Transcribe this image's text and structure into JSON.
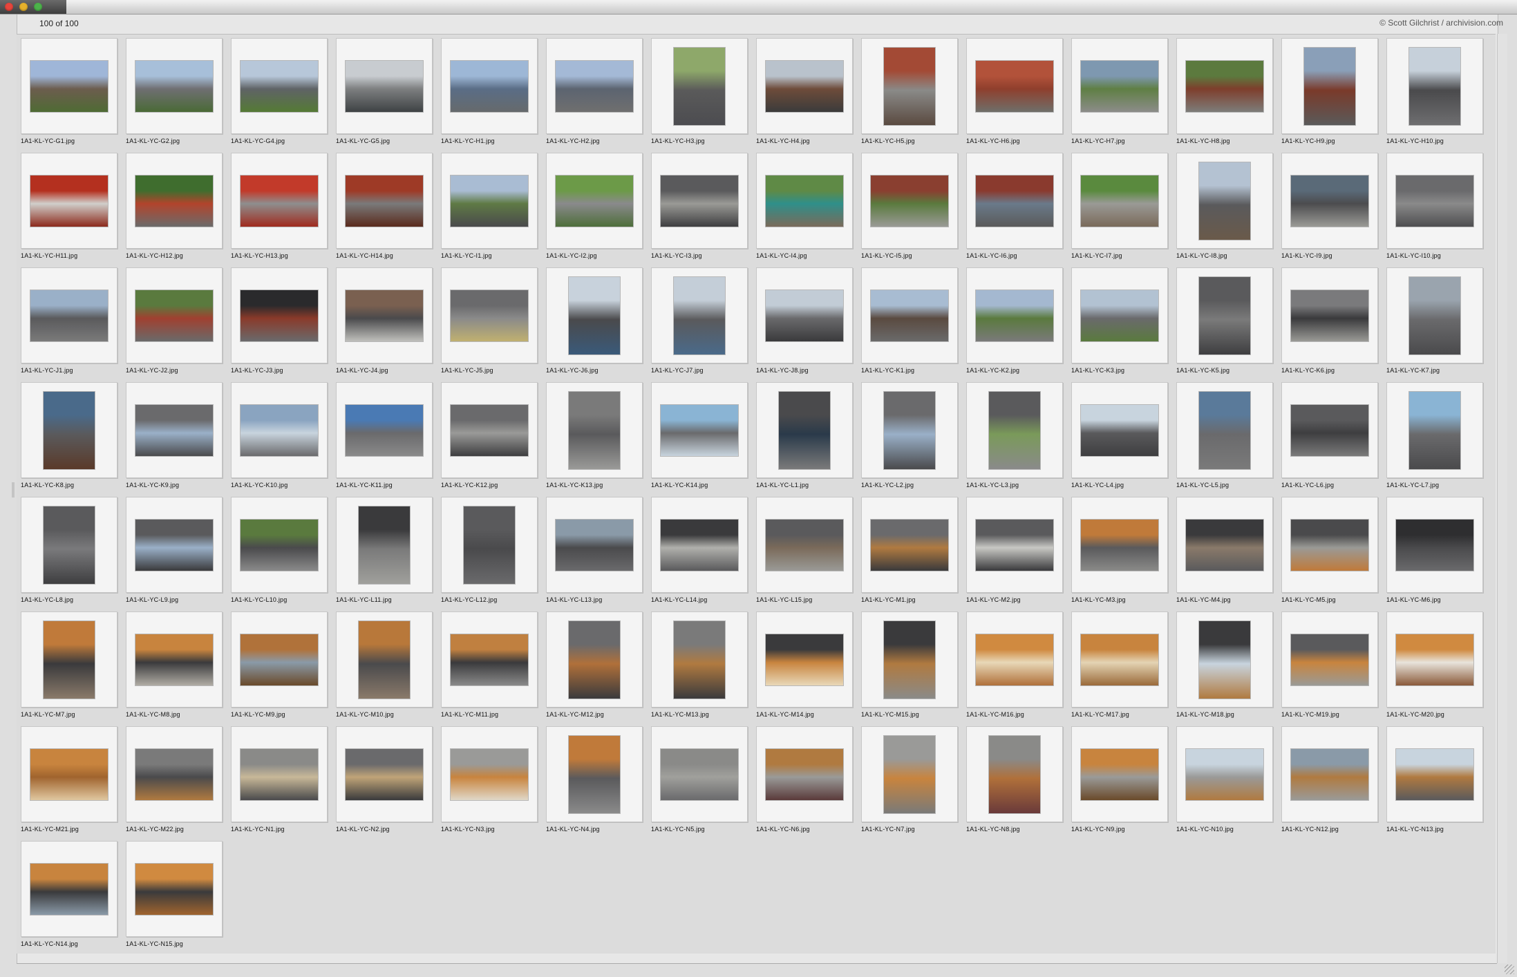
{
  "window": {
    "count_text": "100 of 100",
    "credit_text": "© Scott Gilchrist / archivision.com"
  },
  "thumbnails": [
    {
      "name": "1A1-KL-YC-G1.jpg",
      "orientation": "land",
      "colors": [
        "#9fb6d8",
        "#6c5d4e",
        "#4f6b34"
      ]
    },
    {
      "name": "1A1-KL-YC-G2.jpg",
      "orientation": "land",
      "colors": [
        "#a7bfd9",
        "#6f6f72",
        "#4a6a36"
      ]
    },
    {
      "name": "1A1-KL-YC-G4.jpg",
      "orientation": "land",
      "colors": [
        "#b7c7d9",
        "#5f6366",
        "#557a35"
      ]
    },
    {
      "name": "1A1-KL-YC-G5.jpg",
      "orientation": "land",
      "colors": [
        "#c8ccd0",
        "#7d7f80",
        "#3e4244"
      ]
    },
    {
      "name": "1A1-KL-YC-H1.jpg",
      "orientation": "land",
      "colors": [
        "#9db7d6",
        "#5a6d86",
        "#666a6c"
      ]
    },
    {
      "name": "1A1-KL-YC-H2.jpg",
      "orientation": "land",
      "colors": [
        "#a4b9d6",
        "#5c6470",
        "#6f6f6f"
      ]
    },
    {
      "name": "1A1-KL-YC-H3.jpg",
      "orientation": "port",
      "colors": [
        "#8ea86a",
        "#5a5a5a",
        "#4c4c50"
      ]
    },
    {
      "name": "1A1-KL-YC-H4.jpg",
      "orientation": "land",
      "colors": [
        "#b9c2cc",
        "#6e4c3a",
        "#3b3b3b"
      ]
    },
    {
      "name": "1A1-KL-YC-H5.jpg",
      "orientation": "port",
      "colors": [
        "#a34a35",
        "#8a8a88",
        "#5a4a40"
      ]
    },
    {
      "name": "1A1-KL-YC-H6.jpg",
      "orientation": "land",
      "colors": [
        "#b2523a",
        "#8f3f2d",
        "#6f6f6a"
      ]
    },
    {
      "name": "1A1-KL-YC-H7.jpg",
      "orientation": "land",
      "colors": [
        "#7e98b0",
        "#5f7f44",
        "#8c8c8a"
      ]
    },
    {
      "name": "1A1-KL-YC-H8.jpg",
      "orientation": "land",
      "colors": [
        "#5c7a3e",
        "#7e3e2c",
        "#7d7d7a"
      ]
    },
    {
      "name": "1A1-KL-YC-H9.jpg",
      "orientation": "port",
      "colors": [
        "#8a9fb8",
        "#7a3a2a",
        "#5a5a5a"
      ]
    },
    {
      "name": "1A1-KL-YC-H10.jpg",
      "orientation": "port",
      "colors": [
        "#c6d0da",
        "#4a4a4c",
        "#6e6e70"
      ]
    },
    {
      "name": "1A1-KL-YC-H11.jpg",
      "orientation": "land",
      "colors": [
        "#b4301f",
        "#d0cfcb",
        "#8c2a1c"
      ]
    },
    {
      "name": "1A1-KL-YC-H12.jpg",
      "orientation": "land",
      "colors": [
        "#3f6d2e",
        "#b2442c",
        "#6b6b6b"
      ]
    },
    {
      "name": "1A1-KL-YC-H13.jpg",
      "orientation": "land",
      "colors": [
        "#c23a2a",
        "#8e8e8e",
        "#a02a1e"
      ]
    },
    {
      "name": "1A1-KL-YC-H14.jpg",
      "orientation": "land",
      "colors": [
        "#9e3a26",
        "#7a7a7a",
        "#5a2a1c"
      ]
    },
    {
      "name": "1A1-KL-YC-I1.jpg",
      "orientation": "land",
      "colors": [
        "#a9bcd3",
        "#5f7a45",
        "#4a4a4c"
      ]
    },
    {
      "name": "1A1-KL-YC-I2.jpg",
      "orientation": "land",
      "colors": [
        "#6c9a48",
        "#8a8a8c",
        "#4e6e3a"
      ]
    },
    {
      "name": "1A1-KL-YC-I3.jpg",
      "orientation": "land",
      "colors": [
        "#5a5a5c",
        "#9a9a96",
        "#3e3e40"
      ]
    },
    {
      "name": "1A1-KL-YC-I4.jpg",
      "orientation": "land",
      "colors": [
        "#5f8a46",
        "#2f8f8a",
        "#7a6a5a"
      ]
    },
    {
      "name": "1A1-KL-YC-I5.jpg",
      "orientation": "land",
      "colors": [
        "#8a3f30",
        "#5a7a3e",
        "#9a9a96"
      ]
    },
    {
      "name": "1A1-KL-YC-I6.jpg",
      "orientation": "land",
      "colors": [
        "#8a3a2e",
        "#6a7a8a",
        "#5a5a5a"
      ]
    },
    {
      "name": "1A1-KL-YC-I7.jpg",
      "orientation": "land",
      "colors": [
        "#5a8a3e",
        "#9a9a96",
        "#7a6a5a"
      ]
    },
    {
      "name": "1A1-KL-YC-I8.jpg",
      "orientation": "port",
      "colors": [
        "#b4c2d2",
        "#5a5a5c",
        "#6a5a4a"
      ]
    },
    {
      "name": "1A1-KL-YC-I9.jpg",
      "orientation": "land",
      "colors": [
        "#5a6a78",
        "#4c4c4e",
        "#9a9a96"
      ]
    },
    {
      "name": "1A1-KL-YC-I10.jpg",
      "orientation": "land",
      "colors": [
        "#6a6a6c",
        "#8a8a8a",
        "#4e4e50"
      ]
    },
    {
      "name": "1A1-KL-YC-J1.jpg",
      "orientation": "land",
      "colors": [
        "#9ab0c8",
        "#5a5a5c",
        "#7a7a7a"
      ]
    },
    {
      "name": "1A1-KL-YC-J2.jpg",
      "orientation": "land",
      "colors": [
        "#5a7a3e",
        "#a04030",
        "#6a6a6a"
      ]
    },
    {
      "name": "1A1-KL-YC-J3.jpg",
      "orientation": "land",
      "colors": [
        "#2a2a2c",
        "#8a3a2a",
        "#6a6a6c"
      ]
    },
    {
      "name": "1A1-KL-YC-J4.jpg",
      "orientation": "land",
      "colors": [
        "#7a6050",
        "#4a4a4c",
        "#c0c0bc"
      ]
    },
    {
      "name": "1A1-KL-YC-J5.jpg",
      "orientation": "land",
      "colors": [
        "#6a6a6c",
        "#8a8a8a",
        "#c0b070"
      ]
    },
    {
      "name": "1A1-KL-YC-J6.jpg",
      "orientation": "port",
      "colors": [
        "#c8d2dc",
        "#4a4a4c",
        "#3a5a7a"
      ]
    },
    {
      "name": "1A1-KL-YC-J7.jpg",
      "orientation": "port",
      "colors": [
        "#c4ced8",
        "#5a5a5c",
        "#4a6a8a"
      ]
    },
    {
      "name": "1A1-KL-YC-J8.jpg",
      "orientation": "land",
      "colors": [
        "#c2ccd6",
        "#6a6a6c",
        "#3a3a3c"
      ]
    },
    {
      "name": "1A1-KL-YC-K1.jpg",
      "orientation": "land",
      "colors": [
        "#a8bcd2",
        "#5a4a40",
        "#6a6a6a"
      ]
    },
    {
      "name": "1A1-KL-YC-K2.jpg",
      "orientation": "land",
      "colors": [
        "#a4b8d0",
        "#5a7a3e",
        "#7a7a7a"
      ]
    },
    {
      "name": "1A1-KL-YC-K3.jpg",
      "orientation": "land",
      "colors": [
        "#b2c2d2",
        "#6a6a6c",
        "#5a7a3e"
      ]
    },
    {
      "name": "1A1-KL-YC-K5.jpg",
      "orientation": "port",
      "colors": [
        "#5a5a5c",
        "#7a7a7a",
        "#3e3e40"
      ]
    },
    {
      "name": "1A1-KL-YC-K6.jpg",
      "orientation": "land",
      "colors": [
        "#7a7a7c",
        "#3a3a3c",
        "#9a9a96"
      ]
    },
    {
      "name": "1A1-KL-YC-K7.jpg",
      "orientation": "port",
      "colors": [
        "#9aa4ae",
        "#6a6a6c",
        "#4a4a4c"
      ]
    },
    {
      "name": "1A1-KL-YC-K8.jpg",
      "orientation": "port",
      "colors": [
        "#4a6a8a",
        "#5a5a5c",
        "#5a3a2a"
      ]
    },
    {
      "name": "1A1-KL-YC-K9.jpg",
      "orientation": "land",
      "colors": [
        "#6a6a6c",
        "#9ab0c8",
        "#4a4a4c"
      ]
    },
    {
      "name": "1A1-KL-YC-K10.jpg",
      "orientation": "land",
      "colors": [
        "#8aa4c0",
        "#c8d4de",
        "#6a6a6c"
      ]
    },
    {
      "name": "1A1-KL-YC-K11.jpg",
      "orientation": "land",
      "colors": [
        "#4a7ab4",
        "#6a6a6c",
        "#8a8a8a"
      ]
    },
    {
      "name": "1A1-KL-YC-K12.jpg",
      "orientation": "land",
      "colors": [
        "#6a6a6c",
        "#9a9a98",
        "#3e3e40"
      ]
    },
    {
      "name": "1A1-KL-YC-K13.jpg",
      "orientation": "port",
      "colors": [
        "#7a7a7a",
        "#5a5a5c",
        "#9a9a98"
      ]
    },
    {
      "name": "1A1-KL-YC-K14.jpg",
      "orientation": "land",
      "colors": [
        "#8ab4d4",
        "#6a6a6c",
        "#c8d4de"
      ]
    },
    {
      "name": "1A1-KL-YC-L1.jpg",
      "orientation": "port",
      "colors": [
        "#4a4a4c",
        "#2a3a4a",
        "#7a7a7a"
      ]
    },
    {
      "name": "1A1-KL-YC-L2.jpg",
      "orientation": "port",
      "colors": [
        "#6a6a6c",
        "#9ab0c8",
        "#4a4a4c"
      ]
    },
    {
      "name": "1A1-KL-YC-L3.jpg",
      "orientation": "port",
      "colors": [
        "#5a5a5c",
        "#7a9a5a",
        "#8a8a8a"
      ]
    },
    {
      "name": "1A1-KL-YC-L4.jpg",
      "orientation": "land",
      "colors": [
        "#c8d4de",
        "#5a5a5c",
        "#3e3e40"
      ]
    },
    {
      "name": "1A1-KL-YC-L5.jpg",
      "orientation": "port",
      "colors": [
        "#5a7a9a",
        "#6a6a6c",
        "#7a7a7a"
      ]
    },
    {
      "name": "1A1-KL-YC-L6.jpg",
      "orientation": "land",
      "colors": [
        "#5a5a5c",
        "#3e3e40",
        "#7a7a7a"
      ]
    },
    {
      "name": "1A1-KL-YC-L7.jpg",
      "orientation": "port",
      "colors": [
        "#8ab4d4",
        "#6a6a6c",
        "#4a4a4c"
      ]
    },
    {
      "name": "1A1-KL-YC-L8.jpg",
      "orientation": "port",
      "colors": [
        "#5a5a5c",
        "#7a7a7c",
        "#3e3e40"
      ]
    },
    {
      "name": "1A1-KL-YC-L9.jpg",
      "orientation": "land",
      "colors": [
        "#5a5a5c",
        "#9ab0c8",
        "#3a3a3c"
      ]
    },
    {
      "name": "1A1-KL-YC-L10.jpg",
      "orientation": "land",
      "colors": [
        "#5a7a3e",
        "#4a4a4c",
        "#8a8a8a"
      ]
    },
    {
      "name": "1A1-KL-YC-L11.jpg",
      "orientation": "port",
      "colors": [
        "#3a3a3c",
        "#7a7a7a",
        "#a0a09c"
      ]
    },
    {
      "name": "1A1-KL-YC-L12.jpg",
      "orientation": "port",
      "colors": [
        "#5a5a5c",
        "#4a4a4c",
        "#6a6a6c"
      ]
    },
    {
      "name": "1A1-KL-YC-L13.jpg",
      "orientation": "land",
      "colors": [
        "#8a9aa8",
        "#4a4a4c",
        "#6a6a6c"
      ]
    },
    {
      "name": "1A1-KL-YC-L14.jpg",
      "orientation": "land",
      "colors": [
        "#3a3a3c",
        "#b0b0ac",
        "#5a5a5c"
      ]
    },
    {
      "name": "1A1-KL-YC-L15.jpg",
      "orientation": "land",
      "colors": [
        "#5a5a5c",
        "#7a6a5a",
        "#9a9a96"
      ]
    },
    {
      "name": "1A1-KL-YC-M1.jpg",
      "orientation": "land",
      "colors": [
        "#6a6a6c",
        "#b07a40",
        "#3a3a3c"
      ]
    },
    {
      "name": "1A1-KL-YC-M2.jpg",
      "orientation": "land",
      "colors": [
        "#5a5a5c",
        "#c8c8c4",
        "#3a3a3c"
      ]
    },
    {
      "name": "1A1-KL-YC-M3.jpg",
      "orientation": "land",
      "colors": [
        "#c07a3a",
        "#5a5a5c",
        "#8a8a88"
      ]
    },
    {
      "name": "1A1-KL-YC-M4.jpg",
      "orientation": "land",
      "colors": [
        "#3a3a3c",
        "#8a7a6a",
        "#5a5a5c"
      ]
    },
    {
      "name": "1A1-KL-YC-M5.jpg",
      "orientation": "land",
      "colors": [
        "#4a4a4c",
        "#9a9a96",
        "#c07a3a"
      ]
    },
    {
      "name": "1A1-KL-YC-M6.jpg",
      "orientation": "land",
      "colors": [
        "#2e2e30",
        "#4a4a4c",
        "#6a6a6c"
      ]
    },
    {
      "name": "1A1-KL-YC-M7.jpg",
      "orientation": "port",
      "colors": [
        "#c07a3a",
        "#3a3a3c",
        "#8a7a6a"
      ]
    },
    {
      "name": "1A1-KL-YC-M8.jpg",
      "orientation": "land",
      "colors": [
        "#c8843e",
        "#3a3a3c",
        "#b0aca4"
      ]
    },
    {
      "name": "1A1-KL-YC-M9.jpg",
      "orientation": "land",
      "colors": [
        "#b0723a",
        "#8a9aa8",
        "#6a4a2a"
      ]
    },
    {
      "name": "1A1-KL-YC-M10.jpg",
      "orientation": "port",
      "colors": [
        "#b8783a",
        "#4a4a4c",
        "#8a7a6a"
      ]
    },
    {
      "name": "1A1-KL-YC-M11.jpg",
      "orientation": "land",
      "colors": [
        "#c08040",
        "#3a3a3c",
        "#8a8a8a"
      ]
    },
    {
      "name": "1A1-KL-YC-M12.jpg",
      "orientation": "port",
      "colors": [
        "#6a6a6c",
        "#b0703a",
        "#3a3a3c"
      ]
    },
    {
      "name": "1A1-KL-YC-M13.jpg",
      "orientation": "port",
      "colors": [
        "#7a7a7a",
        "#b07a40",
        "#3a3a3c"
      ]
    },
    {
      "name": "1A1-KL-YC-M14.jpg",
      "orientation": "land",
      "colors": [
        "#3a3a3c",
        "#c8843e",
        "#e8d8b8"
      ]
    },
    {
      "name": "1A1-KL-YC-M15.jpg",
      "orientation": "port",
      "colors": [
        "#3a3a3c",
        "#b07a40",
        "#8a8a88"
      ]
    },
    {
      "name": "1A1-KL-YC-M16.jpg",
      "orientation": "land",
      "colors": [
        "#d08a40",
        "#e8d8b8",
        "#b0703a"
      ]
    },
    {
      "name": "1A1-KL-YC-M17.jpg",
      "orientation": "land",
      "colors": [
        "#c8843e",
        "#e4d4b4",
        "#9a6a3a"
      ]
    },
    {
      "name": "1A1-KL-YC-M18.jpg",
      "orientation": "port",
      "colors": [
        "#3a3a3c",
        "#c8d4de",
        "#b07a40"
      ]
    },
    {
      "name": "1A1-KL-YC-M19.jpg",
      "orientation": "land",
      "colors": [
        "#5a5a5c",
        "#c8843e",
        "#9a9a96"
      ]
    },
    {
      "name": "1A1-KL-YC-M20.jpg",
      "orientation": "land",
      "colors": [
        "#d08a40",
        "#e8e4dc",
        "#8a5a3a"
      ]
    },
    {
      "name": "1A1-KL-YC-M21.jpg",
      "orientation": "land",
      "colors": [
        "#c8843e",
        "#a0642e",
        "#e0c8a0"
      ]
    },
    {
      "name": "1A1-KL-YC-M22.jpg",
      "orientation": "land",
      "colors": [
        "#7a7a7a",
        "#4a4a4c",
        "#b07a40"
      ]
    },
    {
      "name": "1A1-KL-YC-N1.jpg",
      "orientation": "land",
      "colors": [
        "#8a8a88",
        "#c8b898",
        "#4a4a4c"
      ]
    },
    {
      "name": "1A1-KL-YC-N2.jpg",
      "orientation": "land",
      "colors": [
        "#6a6a6c",
        "#c0a478",
        "#3a3a3c"
      ]
    },
    {
      "name": "1A1-KL-YC-N3.jpg",
      "orientation": "land",
      "colors": [
        "#9a9a98",
        "#c8843e",
        "#e0d8c8"
      ]
    },
    {
      "name": "1A1-KL-YC-N4.jpg",
      "orientation": "port",
      "colors": [
        "#c07a3a",
        "#5a5a5c",
        "#8a8a8a"
      ]
    },
    {
      "name": "1A1-KL-YC-N5.jpg",
      "orientation": "land",
      "colors": [
        "#8a8a88",
        "#a0a09c",
        "#6a6a6c"
      ]
    },
    {
      "name": "1A1-KL-YC-N6.jpg",
      "orientation": "land",
      "colors": [
        "#b07a40",
        "#9a9a98",
        "#5a3a3a"
      ]
    },
    {
      "name": "1A1-KL-YC-N7.jpg",
      "orientation": "port",
      "colors": [
        "#9a9a98",
        "#c8843e",
        "#7a7a78"
      ]
    },
    {
      "name": "1A1-KL-YC-N8.jpg",
      "orientation": "port",
      "colors": [
        "#8a8a88",
        "#b0703a",
        "#6a3a3a"
      ]
    },
    {
      "name": "1A1-KL-YC-N9.jpg",
      "orientation": "land",
      "colors": [
        "#c8843e",
        "#9a9a98",
        "#6a4a2a"
      ]
    },
    {
      "name": "1A1-KL-YC-N10.jpg",
      "orientation": "land",
      "colors": [
        "#c8d4de",
        "#9a9a98",
        "#b07a40"
      ]
    },
    {
      "name": "1A1-KL-YC-N12.jpg",
      "orientation": "land",
      "colors": [
        "#8a9aa8",
        "#b07a40",
        "#9a9a98"
      ]
    },
    {
      "name": "1A1-KL-YC-N13.jpg",
      "orientation": "land",
      "colors": [
        "#c8d4de",
        "#b07a40",
        "#5a5a5c"
      ]
    },
    {
      "name": "1A1-KL-YC-N14.jpg",
      "orientation": "land",
      "colors": [
        "#c8843e",
        "#3a3a3c",
        "#8a9aa8"
      ]
    },
    {
      "name": "1A1-KL-YC-N15.jpg",
      "orientation": "land",
      "colors": [
        "#d08a40",
        "#3a3a3c",
        "#a0642e"
      ]
    }
  ]
}
